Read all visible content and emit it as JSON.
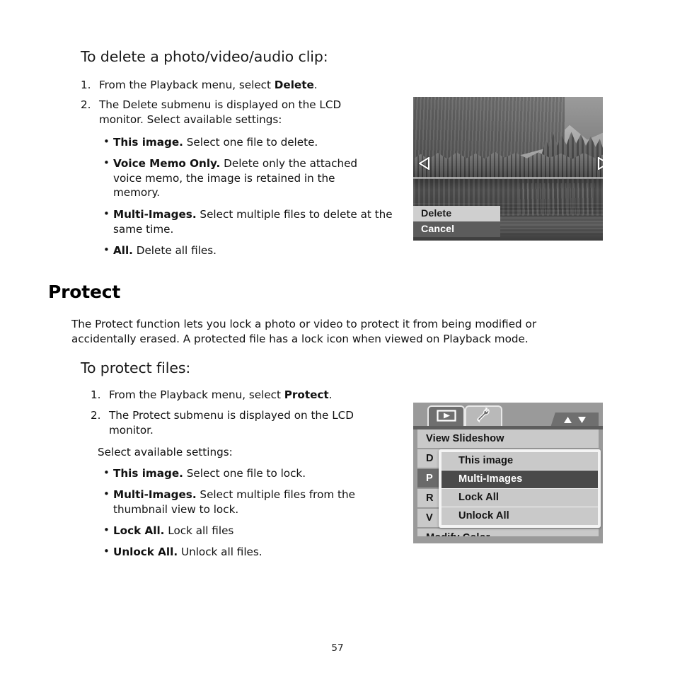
{
  "doc": {
    "page_number": "57"
  },
  "delete_section": {
    "heading": "To delete a photo/video/audio clip:",
    "steps": [
      {
        "marker": "1.",
        "text_before": "From the Playback menu, select ",
        "bold": "Delete",
        "text_after": "."
      },
      {
        "marker": "2.",
        "text_before": "The Delete submenu is displayed on the LCD monitor. Select available settings:",
        "bold": "",
        "text_after": ""
      }
    ],
    "options": [
      {
        "term": "This image.",
        "desc": " Select one file to delete."
      },
      {
        "term": "Voice Memo Only.",
        "desc": " Delete only the attached voice memo, the image is retained in the memory."
      },
      {
        "term": "Multi-Images.",
        "desc": " Select multiple files to delete at the same time."
      },
      {
        "term": "All.",
        "desc": " Delete all files."
      }
    ]
  },
  "protect_section": {
    "heading": "Protect",
    "paragraph": "The Protect function lets you lock a photo or video to protect it from being modified or accidentally erased. A protected file has a lock icon when viewed on Playback mode.",
    "subheading": "To protect files:",
    "steps": [
      {
        "marker": "1.",
        "text_before": "From the Playback menu, select ",
        "bold": "Protect",
        "text_after": "."
      },
      {
        "marker": "2.",
        "text_before": "The Protect submenu is displayed on the LCD monitor.",
        "bold": "",
        "text_after": ""
      }
    ],
    "settings_intro": "Select available settings:",
    "options": [
      {
        "term": "This image.",
        "desc": " Select one file to lock."
      },
      {
        "term": "Multi-Images.",
        "desc": " Select multiple files from the thumbnail view to lock."
      },
      {
        "term": "Lock All.",
        "desc": " Lock all files"
      },
      {
        "term": "Unlock All.",
        "desc": " Unlock all files."
      }
    ]
  },
  "lcd_photo": {
    "caption_scene": "lake-forest-photo",
    "left_arrow": "previous-arrow-icon",
    "right_arrow": "next-arrow-icon",
    "menu": [
      {
        "label": "Delete",
        "selected": false
      },
      {
        "label": "Cancel",
        "selected": true
      }
    ]
  },
  "lcd_menu": {
    "tabs": [
      {
        "name": "playback-tab",
        "icon": "play-icon",
        "active": true
      },
      {
        "name": "setup-tab",
        "icon": "wrench-icon",
        "active": false
      }
    ],
    "scroll_up": "scroll-up-arrow",
    "scroll_down": "scroll-down-arrow",
    "items": [
      {
        "label": "View Slideshow",
        "selected": false
      },
      {
        "label": "D",
        "selected": false
      },
      {
        "label": "P",
        "selected": true
      },
      {
        "label": "R",
        "selected": false
      },
      {
        "label": "V",
        "selected": false
      },
      {
        "label": "Modify Color",
        "selected": false
      }
    ],
    "submenu": [
      {
        "label": "This image",
        "selected": false
      },
      {
        "label": "Multi-Images",
        "selected": true
      },
      {
        "label": "Lock All",
        "selected": false
      },
      {
        "label": "Unlock All",
        "selected": false
      }
    ]
  },
  "colors": {
    "lcd_selected": "#4a4a4a",
    "lcd_row": "#c9c9c9",
    "lcd_frame": "#9a9a9a"
  }
}
